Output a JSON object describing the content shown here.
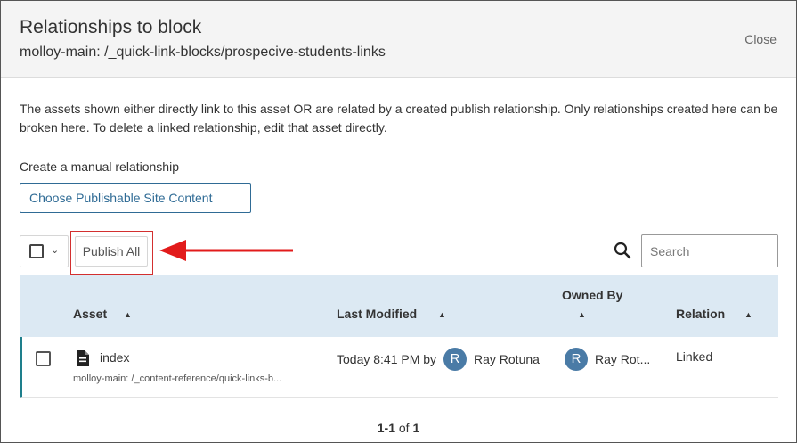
{
  "dialog": {
    "title": "Relationships to block",
    "subtitle": "molloy-main: /_quick-link-blocks/prospecive-students-links",
    "close_label": "Close"
  },
  "description": "The assets shown either directly link to this asset OR are related by a created publish relationship. Only relationships created here can be broken here. To delete a linked relationship, edit that asset directly.",
  "manual": {
    "label": "Create a manual relationship",
    "button_label": "Choose Publishable Site Content"
  },
  "toolbar": {
    "publish_all_label": "Publish All",
    "search_placeholder": "Search"
  },
  "table": {
    "columns": {
      "asset": "Asset",
      "last_modified": "Last Modified",
      "owned_by": "Owned By",
      "relation": "Relation"
    },
    "rows": [
      {
        "name": "index",
        "path": "molloy-main: /_content-reference/quick-links-b...",
        "modified_text": "Today 8:41 PM by",
        "modified_by_initial": "R",
        "modified_by": "Ray Rotuna",
        "owner_initial": "R",
        "owner": "Ray Rot...",
        "relation": "Linked",
        "icon": "document-icon"
      }
    ]
  },
  "pagination": {
    "range": "1-1",
    "of_label": "of",
    "total": "1"
  },
  "colors": {
    "accent": "#2f6b95",
    "header_bg": "#dce9f3",
    "highlight": "#d32f2f",
    "row_marker": "#1e7f8c",
    "avatar": "#4a7ba6"
  }
}
